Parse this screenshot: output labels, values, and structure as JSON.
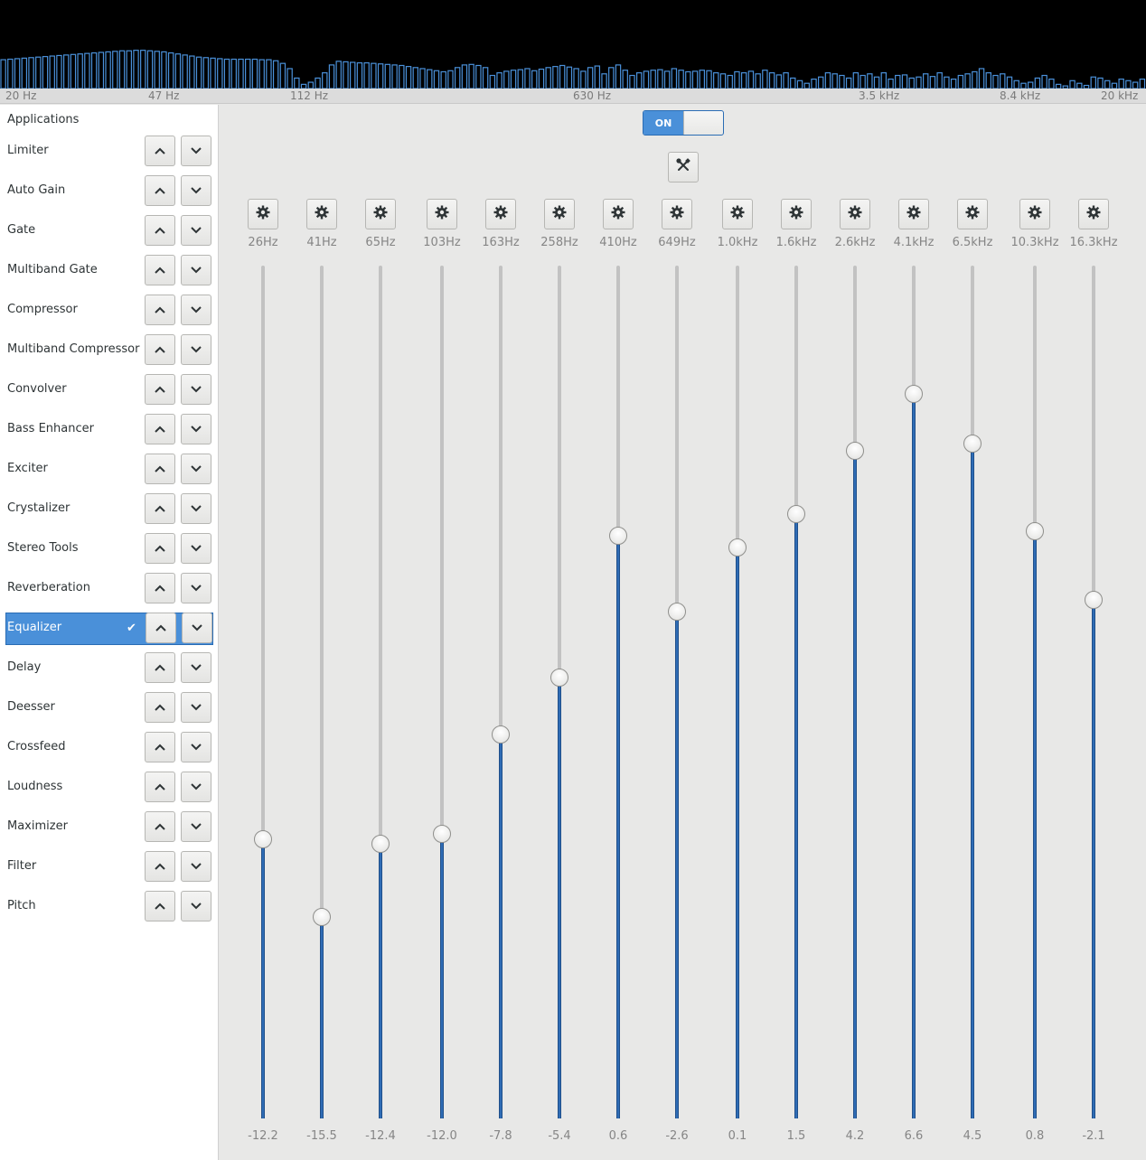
{
  "spectrum": {
    "bar_color": "#4a90d9",
    "axis_labels": [
      "20 Hz",
      "47 Hz",
      "112 Hz",
      "630 Hz",
      "3.5 kHz",
      "8.4 kHz",
      "20 kHz"
    ],
    "levels": [
      0.55,
      0.56,
      0.57,
      0.58,
      0.59,
      0.6,
      0.61,
      0.62,
      0.63,
      0.64,
      0.65,
      0.66,
      0.67,
      0.68,
      0.69,
      0.7,
      0.71,
      0.72,
      0.72,
      0.73,
      0.73,
      0.72,
      0.71,
      0.7,
      0.68,
      0.66,
      0.64,
      0.62,
      0.6,
      0.59,
      0.58,
      0.57,
      0.56,
      0.56,
      0.56,
      0.56,
      0.56,
      0.55,
      0.55,
      0.53,
      0.48,
      0.38,
      0.2,
      0.08,
      0.12,
      0.2,
      0.3,
      0.45,
      0.52,
      0.51,
      0.5,
      0.49,
      0.49,
      0.48,
      0.47,
      0.46,
      0.45,
      0.44,
      0.42,
      0.4,
      0.38,
      0.36,
      0.34,
      0.32,
      0.34,
      0.4,
      0.45,
      0.46,
      0.44,
      0.4,
      0.25,
      0.3,
      0.33,
      0.35,
      0.36,
      0.38,
      0.34,
      0.37,
      0.4,
      0.42,
      0.44,
      0.41,
      0.38,
      0.33,
      0.4,
      0.43,
      0.28,
      0.4,
      0.45,
      0.35,
      0.25,
      0.3,
      0.33,
      0.35,
      0.36,
      0.33,
      0.38,
      0.35,
      0.32,
      0.33,
      0.35,
      0.34,
      0.3,
      0.28,
      0.25,
      0.32,
      0.3,
      0.33,
      0.28,
      0.35,
      0.3,
      0.26,
      0.3,
      0.2,
      0.15,
      0.1,
      0.18,
      0.22,
      0.3,
      0.28,
      0.25,
      0.2,
      0.3,
      0.25,
      0.28,
      0.22,
      0.3,
      0.18,
      0.25,
      0.26,
      0.2,
      0.22,
      0.28,
      0.23,
      0.3,
      0.22,
      0.18,
      0.25,
      0.28,
      0.32,
      0.38,
      0.3,
      0.25,
      0.28,
      0.22,
      0.15,
      0.1,
      0.12,
      0.2,
      0.25,
      0.18,
      0.08,
      0.05,
      0.15,
      0.1,
      0.06,
      0.22,
      0.2,
      0.15,
      0.1,
      0.18,
      0.15,
      0.12,
      0.18
    ]
  },
  "sidebar": {
    "title": "Applications",
    "plugins": [
      {
        "label": "Limiter",
        "selected": false
      },
      {
        "label": "Auto Gain",
        "selected": false
      },
      {
        "label": "Gate",
        "selected": false
      },
      {
        "label": "Multiband Gate",
        "selected": false
      },
      {
        "label": "Compressor",
        "selected": false
      },
      {
        "label": "Multiband Compressor",
        "selected": false
      },
      {
        "label": "Convolver",
        "selected": false
      },
      {
        "label": "Bass Enhancer",
        "selected": false
      },
      {
        "label": "Exciter",
        "selected": false
      },
      {
        "label": "Crystalizer",
        "selected": false
      },
      {
        "label": "Stereo Tools",
        "selected": false
      },
      {
        "label": "Reverberation",
        "selected": false
      },
      {
        "label": "Equalizer",
        "selected": true
      },
      {
        "label": "Delay",
        "selected": false
      },
      {
        "label": "Deesser",
        "selected": false
      },
      {
        "label": "Crossfeed",
        "selected": false
      },
      {
        "label": "Loudness",
        "selected": false
      },
      {
        "label": "Maximizer",
        "selected": false
      },
      {
        "label": "Filter",
        "selected": false
      },
      {
        "label": "Pitch",
        "selected": false
      }
    ],
    "icons": {
      "up": "chevron-up-icon",
      "down": "chevron-down-icon",
      "selected": "checkmark-icon"
    }
  },
  "main": {
    "toggle_label": "ON",
    "toggle_state": true,
    "tools_icon": "tools-icon",
    "band_icon": "gear-icon",
    "gain_range_db": [
      -24,
      12
    ],
    "bands": [
      {
        "freq": "26Hz",
        "gain": "-12.2"
      },
      {
        "freq": "41Hz",
        "gain": "-15.5"
      },
      {
        "freq": "65Hz",
        "gain": "-12.4"
      },
      {
        "freq": "103Hz",
        "gain": "-12.0"
      },
      {
        "freq": "163Hz",
        "gain": "-7.8"
      },
      {
        "freq": "258Hz",
        "gain": "-5.4"
      },
      {
        "freq": "410Hz",
        "gain": "0.6"
      },
      {
        "freq": "649Hz",
        "gain": "-2.6"
      },
      {
        "freq": "1.0kHz",
        "gain": "0.1"
      },
      {
        "freq": "1.6kHz",
        "gain": "1.5"
      },
      {
        "freq": "2.6kHz",
        "gain": "4.2"
      },
      {
        "freq": "4.1kHz",
        "gain": "6.6"
      },
      {
        "freq": "6.5kHz",
        "gain": "4.5"
      },
      {
        "freq": "10.3kHz",
        "gain": "0.8"
      },
      {
        "freq": "16.3kHz",
        "gain": "-2.1"
      }
    ],
    "accent": "#4a90d9"
  }
}
